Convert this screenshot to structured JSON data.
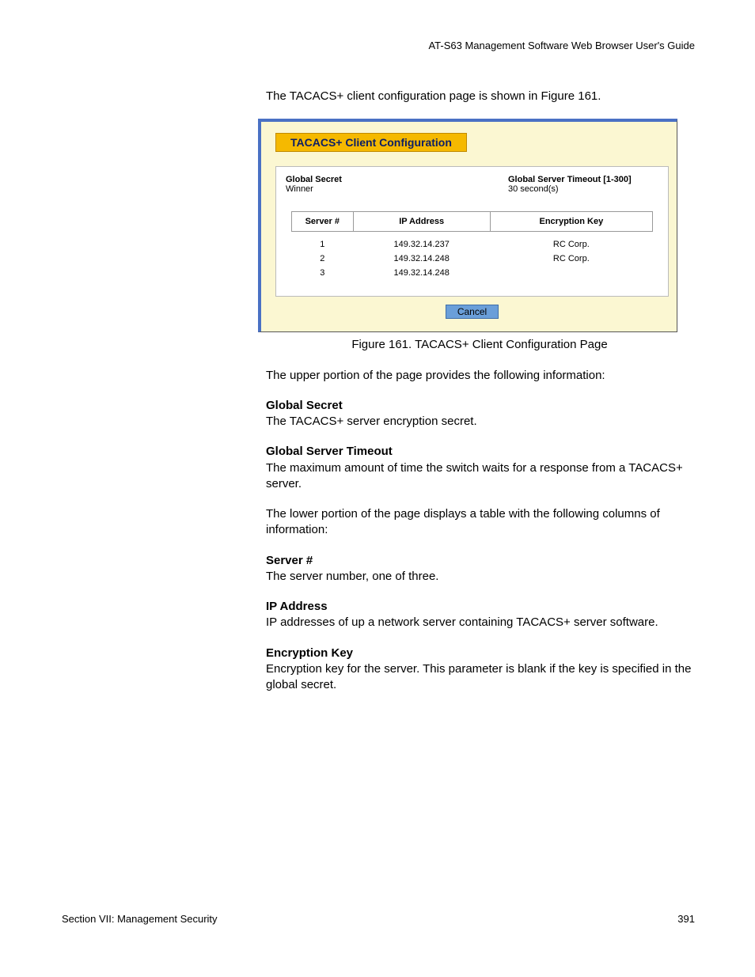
{
  "header": {
    "guide": "AT-S63 Management Software Web Browser User's Guide"
  },
  "intro": "The TACACS+ client configuration page is shown in Figure 161.",
  "screenshot": {
    "title": "TACACS+ Client Configuration",
    "global_secret_label": "Global Secret",
    "global_secret_value": "Winner",
    "global_timeout_label": "Global Server Timeout [1-300]",
    "global_timeout_value": "30 second(s)",
    "columns": {
      "server": "Server #",
      "ip": "IP Address",
      "key": "Encryption Key"
    },
    "rows": [
      {
        "server": "1",
        "ip": "149.32.14.237",
        "key": "RC Corp."
      },
      {
        "server": "2",
        "ip": "149.32.14.248",
        "key": "RC Corp."
      },
      {
        "server": "3",
        "ip": "149.32.14.248",
        "key": ""
      }
    ],
    "cancel": "Cancel"
  },
  "figure_caption": "Figure 161. TACACS+ Client Configuration Page",
  "upper_intro": "The upper portion of the page provides the following information:",
  "defs": {
    "global_secret_term": "Global Secret",
    "global_secret_def": "The TACACS+ server encryption secret.",
    "global_timeout_term": "Global Server Timeout",
    "global_timeout_def": "The maximum amount of time the switch waits for a response from a TACACS+ server.",
    "lower_intro": "The lower portion of the page displays a table with the following columns of information:",
    "server_term": "Server #",
    "server_def": "The server number, one of three.",
    "ip_term": "IP Address",
    "ip_def": "IP addresses of up a network server containing TACACS+ server software.",
    "key_term": "Encryption Key",
    "key_def": "Encryption key for the server. This parameter is blank if the key is specified in the global secret."
  },
  "footer": {
    "section": "Section VII: Management Security",
    "page": "391"
  }
}
